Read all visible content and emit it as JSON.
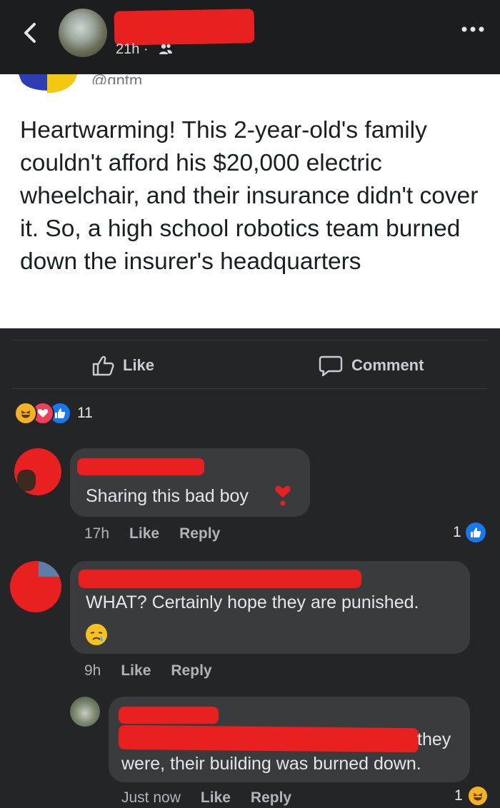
{
  "header": {
    "time": "21h ·"
  },
  "post": {
    "handle": "@qntm",
    "text": "Heartwarming! This 2-year-old's family couldn't afford his $20,000 electric wheelchair, and their insurance didn't cover it. So, a high school robotics team burned down the insurer's headquarters"
  },
  "actions": {
    "like": "Like",
    "comment": "Comment"
  },
  "reactions": {
    "count": "11"
  },
  "comments": [
    {
      "text": "Sharing this bad boy",
      "time": "17h",
      "like": "Like",
      "reply": "Reply",
      "likes": "1"
    },
    {
      "text": "WHAT?  Certainly hope they are punished.",
      "time": "9h",
      "like": "Like",
      "reply": "Reply"
    },
    {
      "line1_tail": "they",
      "line2": "were, their building was burned down.",
      "time": "Just now",
      "like": "Like",
      "reply": "Reply",
      "likes": "1"
    }
  ],
  "colors": {
    "background": "#242526",
    "bubble": "#3a3b3c",
    "redaction": "#e8201f",
    "like_blue": "#1877f2"
  }
}
